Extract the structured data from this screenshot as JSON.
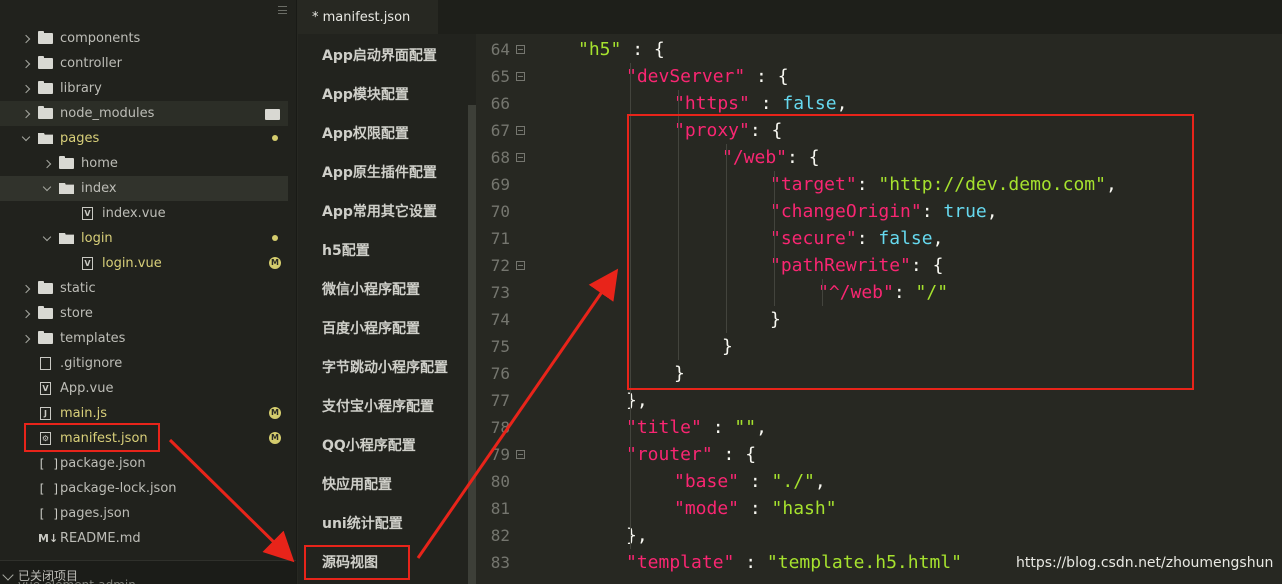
{
  "sidebar": {
    "items": [
      {
        "label": "components",
        "kind": "folder",
        "expand": "right",
        "indent": 0
      },
      {
        "label": "controller",
        "kind": "folder",
        "expand": "right",
        "indent": 0
      },
      {
        "label": "library",
        "kind": "folder",
        "expand": "right",
        "indent": 0
      },
      {
        "label": "node_modules",
        "kind": "folder",
        "expand": "right",
        "indent": 0,
        "badge": "folder"
      },
      {
        "label": "pages",
        "kind": "folder-open",
        "expand": "down",
        "indent": 0,
        "badge": "dot",
        "yellow": true
      },
      {
        "label": "home",
        "kind": "folder",
        "expand": "right",
        "indent": 1
      },
      {
        "label": "index",
        "kind": "folder-open",
        "expand": "down",
        "indent": 1
      },
      {
        "label": "index.vue",
        "kind": "file",
        "glyph": "V",
        "indent": 2
      },
      {
        "label": "login",
        "kind": "folder-open",
        "expand": "down",
        "indent": 1,
        "badge": "dot",
        "yellow": true
      },
      {
        "label": "login.vue",
        "kind": "file",
        "glyph": "V",
        "indent": 2,
        "badge": "M",
        "yellow": true
      },
      {
        "label": "static",
        "kind": "folder",
        "expand": "right",
        "indent": 0
      },
      {
        "label": "store",
        "kind": "folder",
        "expand": "right",
        "indent": 0
      },
      {
        "label": "templates",
        "kind": "folder",
        "expand": "right",
        "indent": 0
      },
      {
        "label": ".gitignore",
        "kind": "file",
        "glyph": "",
        "indent": 0
      },
      {
        "label": "App.vue",
        "kind": "file",
        "glyph": "V",
        "indent": 0
      },
      {
        "label": "main.js",
        "kind": "file",
        "glyph": "J",
        "indent": 0,
        "badge": "M",
        "yellow": true
      },
      {
        "label": "manifest.json",
        "kind": "file",
        "glyph": "⚙",
        "indent": 0,
        "badge": "M",
        "yellow": true
      },
      {
        "label": "package.json",
        "kind": "bracket",
        "indent": 0
      },
      {
        "label": "package-lock.json",
        "kind": "bracket",
        "indent": 0
      },
      {
        "label": "pages.json",
        "kind": "bracket",
        "indent": 0
      },
      {
        "label": "README.md",
        "kind": "md",
        "indent": 0
      }
    ],
    "footer": "已关闭项目",
    "footer_cut": "vue-element-admin"
  },
  "tab": {
    "label": "* manifest.json"
  },
  "config_items": [
    "App启动界面配置",
    "App模块配置",
    "App权限配置",
    "App原生插件配置",
    "App常用其它设置",
    "h5配置",
    "微信小程序配置",
    "百度小程序配置",
    "字节跳动小程序配置",
    "支付宝小程序配置",
    "QQ小程序配置",
    "快应用配置",
    "uni统计配置",
    "源码视图"
  ],
  "code_lines": [
    {
      "n": "64",
      "fold": true,
      "indent": 0,
      "parts": [
        [
          "s",
          "\"h5\""
        ],
        [
          "p",
          " : {"
        ]
      ]
    },
    {
      "n": "65",
      "fold": true,
      "indent": 1,
      "parts": [
        [
          "k",
          "\"devServer\""
        ],
        [
          "p",
          " : {"
        ]
      ]
    },
    {
      "n": "66",
      "fold": false,
      "indent": 2,
      "parts": [
        [
          "k",
          "\"https\""
        ],
        [
          "p",
          " : "
        ],
        [
          "b",
          "false"
        ],
        [
          "p",
          ","
        ]
      ]
    },
    {
      "n": "67",
      "fold": true,
      "indent": 2,
      "parts": [
        [
          "k",
          "\"proxy\""
        ],
        [
          "p",
          ": {"
        ]
      ]
    },
    {
      "n": "68",
      "fold": true,
      "indent": 3,
      "parts": [
        [
          "k",
          "\"/web\""
        ],
        [
          "p",
          ": {"
        ]
      ]
    },
    {
      "n": "69",
      "fold": false,
      "indent": 4,
      "parts": [
        [
          "k",
          "\"target\""
        ],
        [
          "p",
          ": "
        ],
        [
          "s",
          "\"http://dev.demo.com\""
        ],
        [
          "p",
          ","
        ]
      ]
    },
    {
      "n": "70",
      "fold": false,
      "indent": 4,
      "parts": [
        [
          "k",
          "\"changeOrigin\""
        ],
        [
          "p",
          ": "
        ],
        [
          "b",
          "true"
        ],
        [
          "p",
          ","
        ]
      ]
    },
    {
      "n": "71",
      "fold": false,
      "indent": 4,
      "parts": [
        [
          "k",
          "\"secure\""
        ],
        [
          "p",
          ": "
        ],
        [
          "b",
          "false"
        ],
        [
          "p",
          ","
        ]
      ]
    },
    {
      "n": "72",
      "fold": true,
      "indent": 4,
      "parts": [
        [
          "k",
          "\"pathRewrite\""
        ],
        [
          "p",
          ": {"
        ]
      ]
    },
    {
      "n": "73",
      "fold": false,
      "indent": 5,
      "parts": [
        [
          "k",
          "\"^/web\""
        ],
        [
          "p",
          ": "
        ],
        [
          "s",
          "\"/\""
        ]
      ]
    },
    {
      "n": "74",
      "fold": false,
      "indent": 4,
      "parts": [
        [
          "p",
          "}"
        ]
      ]
    },
    {
      "n": "75",
      "fold": false,
      "indent": 3,
      "parts": [
        [
          "p",
          "}"
        ]
      ]
    },
    {
      "n": "76",
      "fold": false,
      "indent": 2,
      "parts": [
        [
          "p",
          "}"
        ]
      ]
    },
    {
      "n": "77",
      "fold": false,
      "indent": 1,
      "parts": [
        [
          "p",
          "},"
        ]
      ]
    },
    {
      "n": "78",
      "fold": false,
      "indent": 1,
      "parts": [
        [
          "k",
          "\"title\""
        ],
        [
          "p",
          " : "
        ],
        [
          "s",
          "\"\""
        ],
        [
          "p",
          ","
        ]
      ]
    },
    {
      "n": "79",
      "fold": true,
      "indent": 1,
      "parts": [
        [
          "k",
          "\"router\""
        ],
        [
          "p",
          " : {"
        ]
      ]
    },
    {
      "n": "80",
      "fold": false,
      "indent": 2,
      "parts": [
        [
          "k",
          "\"base\""
        ],
        [
          "p",
          " : "
        ],
        [
          "s",
          "\"./\""
        ],
        [
          "p",
          ","
        ]
      ]
    },
    {
      "n": "81",
      "fold": false,
      "indent": 2,
      "parts": [
        [
          "k",
          "\"mode\""
        ],
        [
          "p",
          " : "
        ],
        [
          "s",
          "\"hash\""
        ]
      ]
    },
    {
      "n": "82",
      "fold": false,
      "indent": 1,
      "parts": [
        [
          "p",
          "},"
        ]
      ]
    },
    {
      "n": "83",
      "fold": false,
      "indent": 1,
      "parts": [
        [
          "k",
          "\"template\""
        ],
        [
          "p",
          " : "
        ],
        [
          "s",
          "\"template.h5.html\""
        ]
      ]
    }
  ],
  "watermark": "https://blog.csdn.net/zhoumengshun",
  "colors": {
    "annotation_red": "#e8241a",
    "key": "#f92672",
    "string": "#a6e22e",
    "boolean": "#66d9ef",
    "background": "#272822"
  }
}
